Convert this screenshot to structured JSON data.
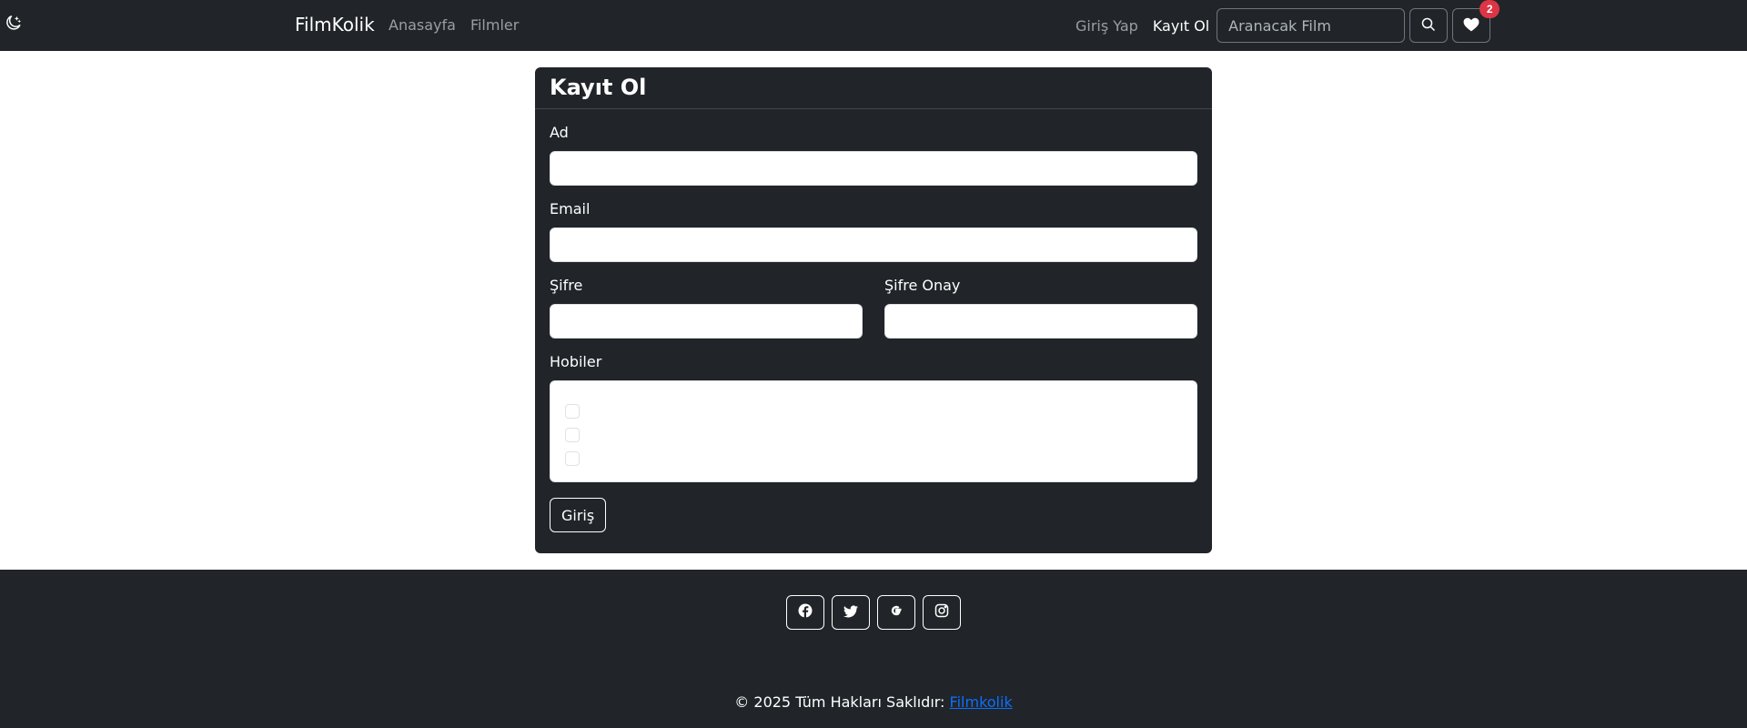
{
  "navbar": {
    "brand": "FilmKolik",
    "links": [
      {
        "label": "Anasayfa"
      },
      {
        "label": "Filmler"
      }
    ],
    "login_label": "Giriş Yap",
    "register_label": "Kayıt Ol",
    "search_placeholder": "Aranacak Film",
    "favorites_count": "2",
    "icons": [
      "moon-stars-icon",
      "search-icon",
      "heart-icon"
    ]
  },
  "form": {
    "title": "Kayıt Ol",
    "name_label": "Ad",
    "email_label": "Email",
    "password_label": "Şifre",
    "password_confirm_label": "Şifre Onay",
    "hobbies_label": "Hobiler",
    "hobbies": [
      {
        "label": "",
        "checked": false
      },
      {
        "label": "",
        "checked": false
      },
      {
        "label": "",
        "checked": false
      }
    ],
    "submit_label": "Giriş"
  },
  "footer": {
    "social_icons": [
      "facebook-icon",
      "twitter-icon",
      "google-icon",
      "instagram-icon"
    ],
    "copyright_text": "© 2025 Tüm Hakları Saklıdır:",
    "copyright_link": "Filmkolik"
  },
  "colors": {
    "dark": "#212529",
    "badge": "#dc3545",
    "link": "#0d6efd"
  }
}
